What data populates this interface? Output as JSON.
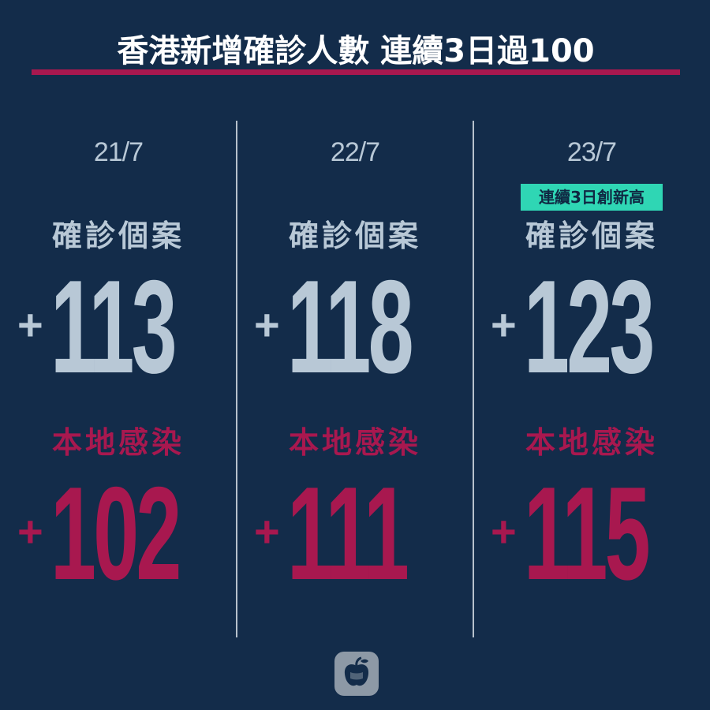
{
  "header": {
    "title": "香港新增確診人數 連續3日過100"
  },
  "badge": {
    "text": "連續3日創新高"
  },
  "days": [
    {
      "date": "21/7",
      "cases_label": "確診個案",
      "cases_plus": "+",
      "cases": "113",
      "local_label": "本地感染",
      "local_plus": "+",
      "local": "102"
    },
    {
      "date": "22/7",
      "cases_label": "確診個案",
      "cases_plus": "+",
      "cases": "118",
      "local_label": "本地感染",
      "local_plus": "+",
      "local": "111"
    },
    {
      "date": "23/7",
      "cases_label": "確診個案",
      "cases_plus": "+",
      "cases": "123",
      "local_label": "本地感染",
      "local_plus": "+",
      "local": "115"
    }
  ],
  "colors": {
    "background": "#132c4a",
    "title": "#ffffff",
    "accent": "#a8184f",
    "primary_text": "#b8c8d6",
    "badge": "#2fd6b4"
  },
  "logo": {
    "icon": "apple-icon"
  }
}
